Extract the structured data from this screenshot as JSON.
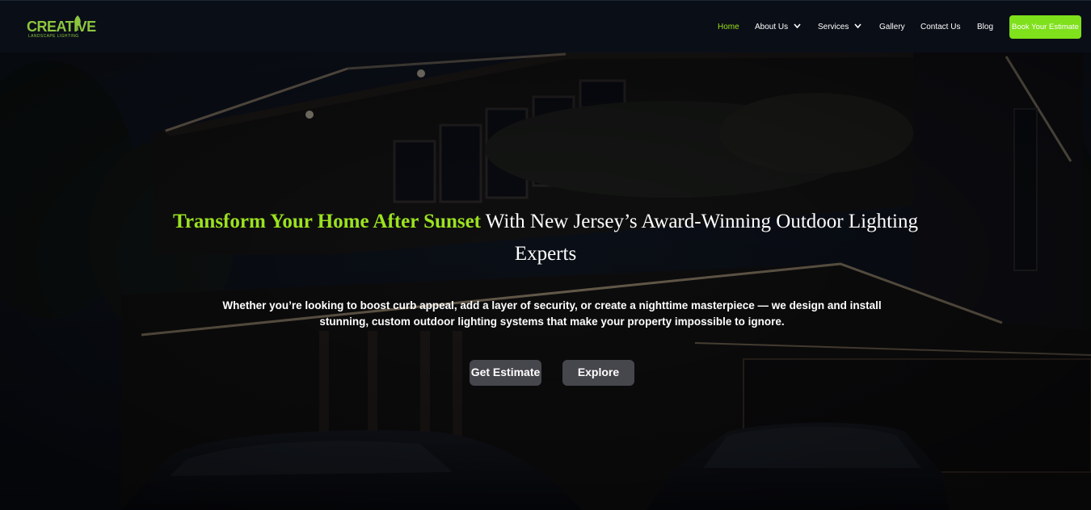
{
  "brand": {
    "logo_word": "CREATIVE",
    "logo_tagline": "LANDSCAPE LIGHTING",
    "accent_color": "#9be21f",
    "cta_color": "#7fe01c"
  },
  "nav": {
    "items": [
      {
        "label": "Home",
        "active": true
      },
      {
        "label": "About Us",
        "dropdown": true
      },
      {
        "label": "Services",
        "dropdown": true
      },
      {
        "label": "Gallery"
      },
      {
        "label": "Contact Us"
      },
      {
        "label": "Blog"
      }
    ],
    "cta_label": "Book Your Estimate"
  },
  "hero": {
    "headline_highlight": "Transform Your Home After Sunset",
    "headline_rest": " With New Jersey’s Award-Winning Outdoor Lighting Experts",
    "subtext": "Whether you’re looking to boost curb appeal, add a layer of security, or create a nighttime masterpiece — we design and install stunning, custom outdoor lighting systems that make your property impossible to ignore.",
    "primary_button": "Get Estimate",
    "secondary_button": "Explore",
    "background_image": "night-house-with-led-lighting-and-cars"
  }
}
